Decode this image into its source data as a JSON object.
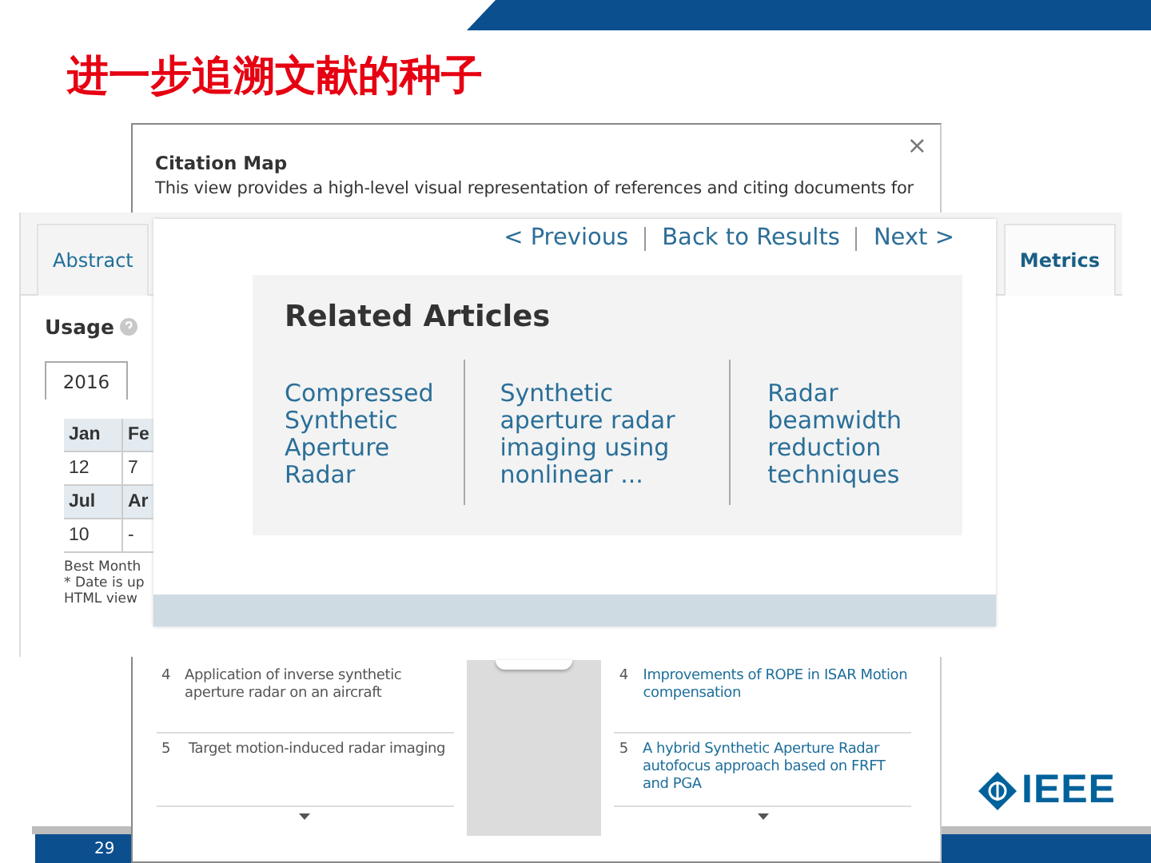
{
  "slide": {
    "title": "进一步追溯文献的种子",
    "page_number": "29",
    "logo_text": "IEEE"
  },
  "citation_map": {
    "title": "Citation Map",
    "close": "×",
    "description": "This view provides a high-level visual representation of references and citing documents for",
    "columns": [
      {
        "kind": "text",
        "items": [
          {
            "number": "4",
            "title": "Application of inverse synthetic aperture radar on an aircraft"
          },
          {
            "number": "5",
            "title": "Target motion-induced radar imaging"
          }
        ]
      },
      {
        "kind": "link",
        "items": [
          {
            "number": "4",
            "title": "Improvements of ROPE in ISAR Motion compensation"
          },
          {
            "number": "5",
            "title": "A hybrid Synthetic Aperture Radar autofocus approach based on FRFT and PGA"
          }
        ]
      }
    ]
  },
  "usage_page": {
    "tabs": [
      {
        "label": "Abstract",
        "selected": false
      },
      {
        "label": "Metrics",
        "selected": true
      }
    ],
    "usage_title": "Usage",
    "year_tab": {
      "label": "2016",
      "selected": true
    },
    "table": {
      "rows": [
        {
          "kind": "header",
          "cells": [
            "Jan",
            "Fe"
          ]
        },
        {
          "kind": "data",
          "cells": [
            "12",
            "7"
          ]
        },
        {
          "kind": "header",
          "cells": [
            "Jul",
            "Ar"
          ]
        },
        {
          "kind": "data",
          "cells": [
            "10",
            "-"
          ]
        }
      ]
    },
    "notes": [
      "Best Month",
      "* Date is up",
      "HTML view"
    ]
  },
  "article_page": {
    "nav": [
      "< Previous",
      "Back to Results",
      "Next >"
    ],
    "related": {
      "title": "Related Articles",
      "items": [
        "Compressed Synthetic Aperture Radar",
        "Synthetic aperture radar imaging using nonlinear ...",
        "Radar beamwidth reduction techniques"
      ]
    }
  }
}
